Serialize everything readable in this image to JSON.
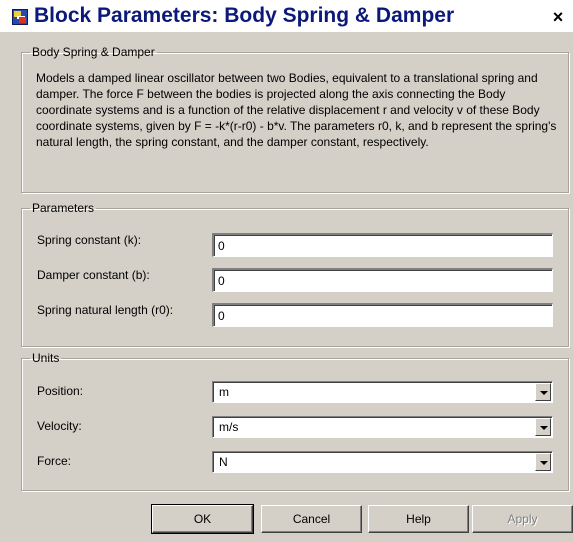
{
  "window": {
    "title": "Block Parameters: Body Spring & Damper",
    "close_glyph": "×",
    "icon": "simulink-block-icon"
  },
  "block_group": {
    "legend": "Body Spring & Damper",
    "description": "Models a damped linear oscillator between two Bodies, equivalent to a translational spring and damper. The force F between the bodies is projected along the axis connecting the Body coordinate systems and is a function of the relative displacement r and velocity v of these Body coordinate systems, given by F = -k*(r-r0) - b*v. The parameters r0, k, and b represent the spring's natural length, the spring constant, and the damper constant, respectively."
  },
  "parameters": {
    "legend": "Parameters",
    "fields": [
      {
        "label": "Spring constant (k):",
        "value": "0"
      },
      {
        "label": "Damper constant (b):",
        "value": "0"
      },
      {
        "label": "Spring natural length (r0):",
        "value": "0"
      }
    ]
  },
  "units": {
    "legend": "Units",
    "fields": [
      {
        "label": "Position:",
        "value": "m"
      },
      {
        "label": "Velocity:",
        "value": "m/s"
      },
      {
        "label": "Force:",
        "value": "N"
      }
    ]
  },
  "buttons": {
    "ok": "OK",
    "cancel": "Cancel",
    "help": "Help",
    "apply": "Apply"
  }
}
